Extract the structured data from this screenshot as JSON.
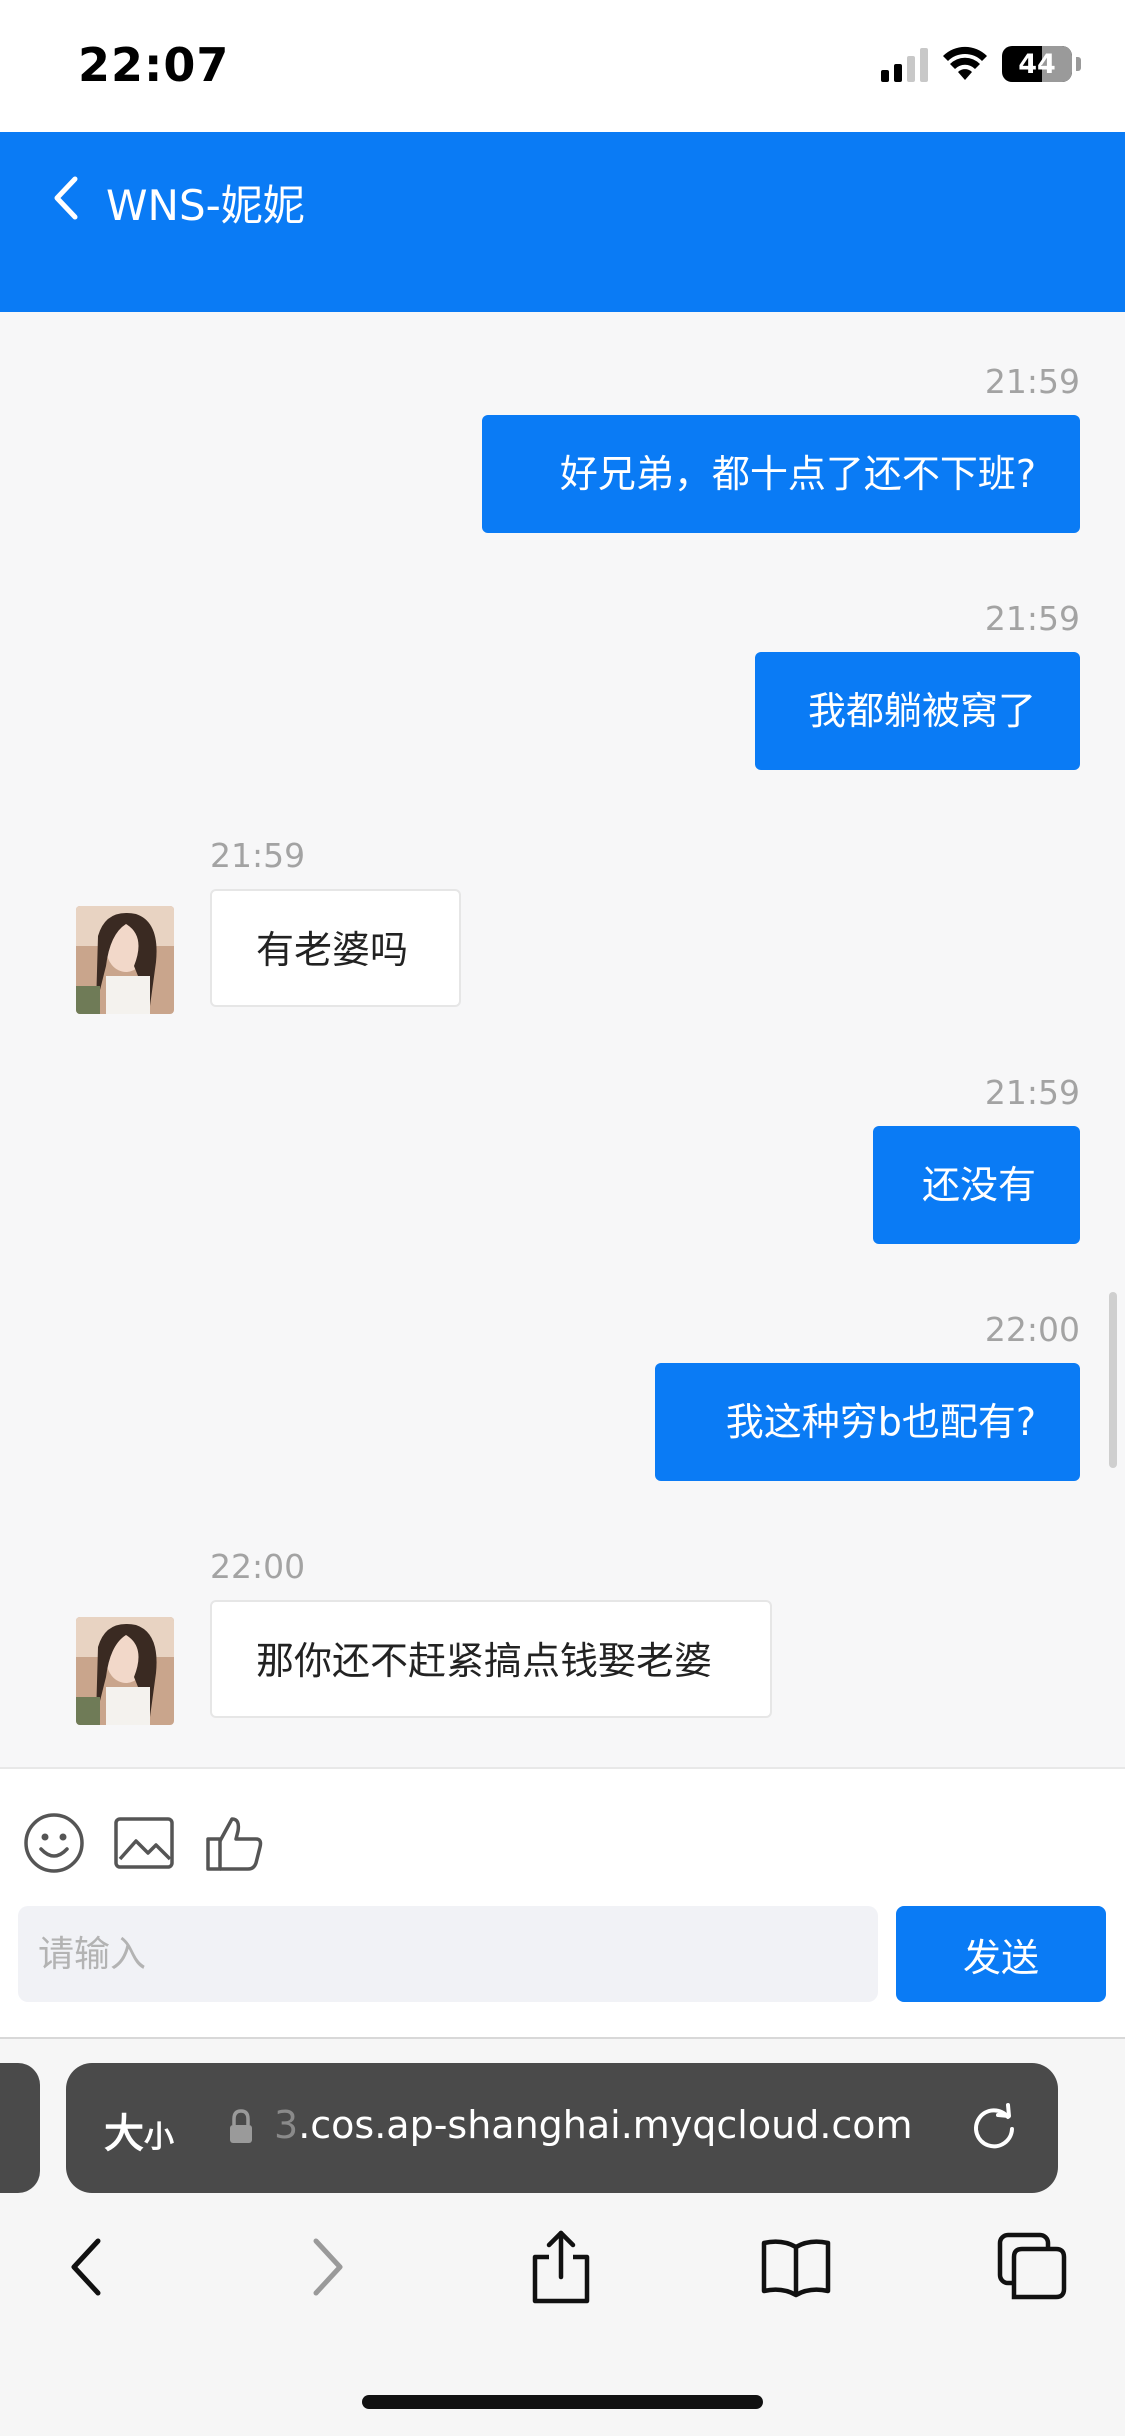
{
  "status_bar": {
    "time": "22:07",
    "battery": "44",
    "signal_icon": "cellular-signal-icon",
    "wifi_icon": "wifi-icon"
  },
  "header": {
    "title": "WNS-妮妮",
    "back_icon": "chevron-left-icon",
    "bg_color": "#0a7bf5"
  },
  "messages": [
    {
      "side": "sent",
      "time": "21:59",
      "text": "好兄弟，都十点了还不下班?"
    },
    {
      "side": "sent",
      "time": "21:59",
      "text": "我都躺被窝了"
    },
    {
      "side": "received",
      "time": "21:59",
      "text": "有老婆吗"
    },
    {
      "side": "sent",
      "time": "21:59",
      "text": "还没有"
    },
    {
      "side": "sent",
      "time": "22:00",
      "text": "我这种穷b也配有?"
    },
    {
      "side": "received",
      "time": "22:00",
      "text": "那你还不赶紧搞点钱娶老婆"
    }
  ],
  "composer": {
    "tools": [
      "smiley-icon",
      "image-icon",
      "thumbs-up-icon"
    ],
    "input_placeholder": "请输入",
    "input_value": "",
    "send_label": "发送"
  },
  "browser": {
    "text_size_big": "大",
    "text_size_small": "小",
    "url_faded": "3",
    "url": ".cos.ap-shanghai.myqcloud.com",
    "nav_icons": [
      "back-icon",
      "forward-icon",
      "share-icon",
      "bookmarks-icon",
      "tabs-icon"
    ]
  }
}
